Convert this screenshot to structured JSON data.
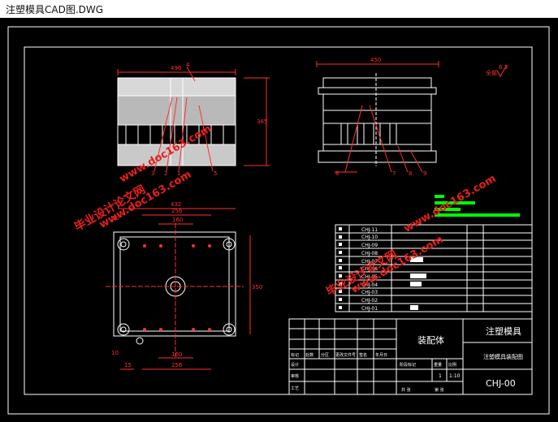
{
  "window": {
    "title": "注塑模具CAD图.DWG"
  },
  "colors": {
    "background": "#000000",
    "line": "#ffffff",
    "dimension": "#ff3030",
    "border": "#ffffff",
    "watermark": "#e8201a",
    "highlight": "#00ff00"
  },
  "drawing": {
    "top_view": {
      "dims": {
        "width": "496",
        "height": "365"
      },
      "callouts": [
        "4",
        "3",
        "2",
        "1",
        "5"
      ]
    },
    "side_view": {
      "dims": {
        "width": "450"
      },
      "callouts": [
        "6",
        "7",
        "8",
        "9"
      ],
      "roughness": {
        "label": "全部",
        "value": "6.3"
      }
    },
    "plan_view": {
      "dims": {
        "overall": "432",
        "inner": "256",
        "middle": "160",
        "side_small": "10",
        "height": "350",
        "bottom_inner": "160",
        "bottom_outer": "256",
        "bottom_left": "15",
        "left_offset": "10"
      }
    },
    "parts_list": {
      "codes": [
        "CHJ-11",
        "CHJ-10",
        "CHJ-09",
        "CHJ-08",
        "CHJ-07",
        "CHJ-06",
        "CHJ-05",
        "CHJ-04",
        "CHJ-03",
        "CHJ-02",
        "CHJ-01"
      ]
    },
    "title_block": {
      "assembly": "装配体",
      "product": "注塑模具",
      "drawing_name": "注塑模具装配图",
      "drawing_no": "CHJ-00",
      "labels": {
        "mark": "标记",
        "qty": "处数",
        "zone": "分区",
        "change": "更改文件号",
        "sign": "签名",
        "date": "年月日",
        "design": "设计",
        "check": "审核",
        "craft": "工艺",
        "stage": "阶段标记",
        "weight": "重量",
        "scale": "比例",
        "sheets": "共 张",
        "sheet": "第 张"
      },
      "values": {
        "qty_val": "1",
        "scale_val": "1:10"
      }
    }
  },
  "watermarks": [
    {
      "text1": "毕业设计论文网",
      "text2": "www.doc163.com"
    },
    {
      "text1": "毕业设计论文网",
      "text2": "www.doc163.com"
    },
    {
      "text1": "毕业设计论文网",
      "text2": "www.doc163.com"
    }
  ]
}
